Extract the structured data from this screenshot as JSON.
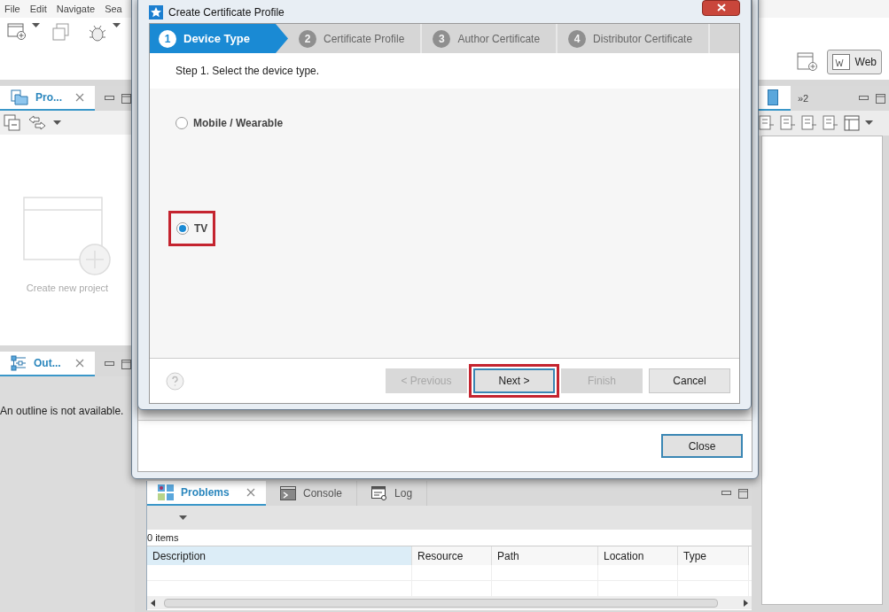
{
  "ide": {
    "menu": [
      "File",
      "Edit",
      "Navigate",
      "Sea"
    ],
    "perspective_button": "Web",
    "project_view": {
      "tab": "Pro...",
      "empty_hint": "Create new project"
    },
    "outline_view": {
      "tab": "Out...",
      "message": "An outline is not available."
    },
    "right_view": {
      "tab_overflow": "»2"
    },
    "bottom_view": {
      "tabs": [
        {
          "label": "Problems",
          "selected": true
        },
        {
          "label": "Console",
          "selected": false
        },
        {
          "label": "Log",
          "selected": false
        }
      ],
      "count": "0 items",
      "columns": [
        "Description",
        "Resource",
        "Path",
        "Location",
        "Type"
      ]
    }
  },
  "back_dialog": {
    "buttons": [
      "Close"
    ]
  },
  "wizard": {
    "title": "Create Certificate Profile",
    "steps": [
      {
        "number": "1",
        "label": "Device Type",
        "selected": true
      },
      {
        "number": "2",
        "label": "Certificate Profile",
        "selected": false
      },
      {
        "number": "3",
        "label": "Author Certificate",
        "selected": false
      },
      {
        "number": "4",
        "label": "Distributor Certificate",
        "selected": false
      }
    ],
    "instruction": "Step 1. Select the device type.",
    "options": [
      {
        "label": "Mobile / Wearable",
        "selected": false,
        "highlighted": false
      },
      {
        "label": "TV",
        "selected": true,
        "highlighted": true
      }
    ],
    "buttons": [
      {
        "label": "< Previous",
        "disabled": true,
        "highlighted": false
      },
      {
        "label": "Next >",
        "disabled": false,
        "highlighted": true
      },
      {
        "label": "Finish",
        "disabled": true,
        "highlighted": false
      },
      {
        "label": "Cancel",
        "disabled": false,
        "highlighted": false
      }
    ]
  }
}
